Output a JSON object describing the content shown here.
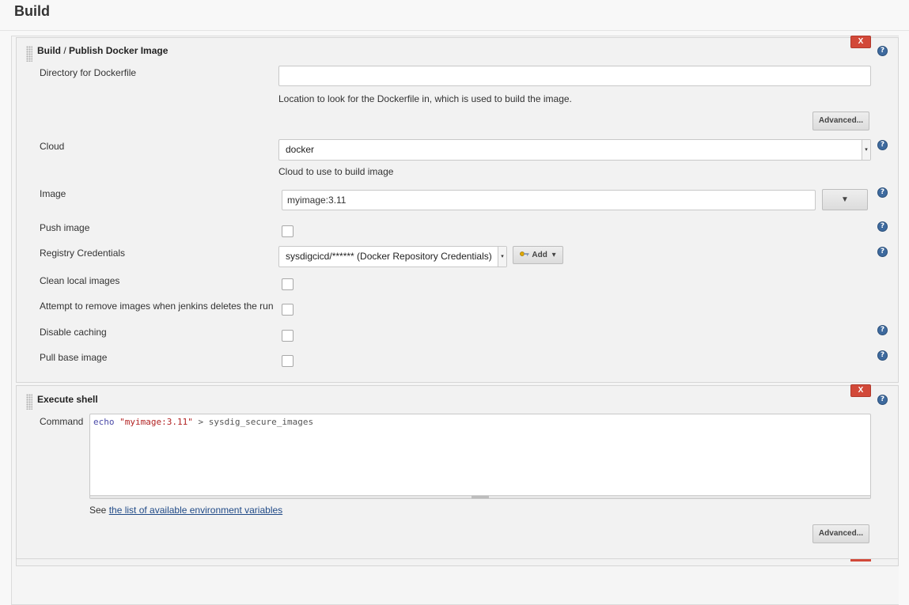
{
  "header": {
    "title": "Build"
  },
  "docker_step": {
    "title_part1": "Build",
    "title_sep": "/",
    "title_part2": "Publish Docker Image",
    "delete_label": "X",
    "help_glyph": "?",
    "dockerfile_dir": {
      "label": "Directory for Dockerfile",
      "value": "",
      "description": "Location to look for the Dockerfile in, which is used to build the image."
    },
    "advanced_label": "Advanced...",
    "cloud": {
      "label": "Cloud",
      "value": "docker",
      "description": "Cloud to use to build image"
    },
    "image": {
      "label": "Image",
      "value": "myimage:3.11",
      "dropdown_glyph": "▼"
    },
    "push_image": {
      "label": "Push image",
      "checked": false
    },
    "registry_credentials": {
      "label": "Registry Credentials",
      "value": "sysdigcicd/****** (Docker Repository Credentials)",
      "add_label": "Add"
    },
    "clean_local_images": {
      "label": "Clean local images",
      "checked": false
    },
    "remove_images": {
      "label": "Attempt to remove images when jenkins deletes the run",
      "checked": false
    },
    "disable_caching": {
      "label": "Disable caching",
      "checked": false
    },
    "pull_base_image": {
      "label": "Pull base image",
      "checked": false
    }
  },
  "shell_step": {
    "title": "Execute shell",
    "delete_label": "X",
    "command": {
      "label": "Command",
      "code_keyword": "echo",
      "code_string": "\"myimage:3.11\"",
      "code_rest": " > sysdig_secure_images"
    },
    "see_prefix": "See",
    "env_link": "the list of available environment variables",
    "advanced_label": "Advanced..."
  },
  "colors": {
    "delete": "#d24939",
    "help": "#3e6a9e",
    "link": "#204a87"
  },
  "icons": {
    "grip": "drag-handle-icon",
    "help": "help-icon",
    "key": "key-icon",
    "caret": "caret-down-icon"
  }
}
